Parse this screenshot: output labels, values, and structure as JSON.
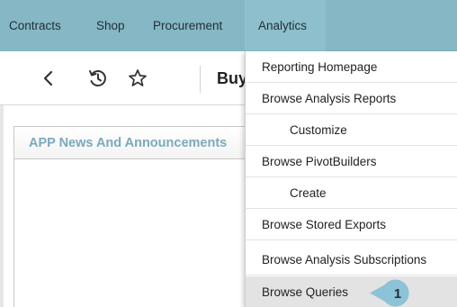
{
  "nav": {
    "items": [
      {
        "label": "Contracts"
      },
      {
        "label": "Shop"
      },
      {
        "label": "Procurement"
      },
      {
        "label": "Analytics"
      }
    ],
    "active_index": 3,
    "bar_color": "#86b7c5"
  },
  "toolbar": {
    "back_icon": "chevron-left-icon",
    "history_icon": "history-icon",
    "favorite_icon": "star-icon",
    "title": "Buy"
  },
  "panel": {
    "title": "APP News And Announcements"
  },
  "analytics_menu": {
    "items": [
      {
        "label": "Reporting Homepage",
        "sub": false
      },
      {
        "label": "Browse Analysis Reports",
        "sub": false
      },
      {
        "label": "Customize",
        "sub": true
      },
      {
        "label": "Browse PivotBuilders",
        "sub": false
      },
      {
        "label": "Create",
        "sub": true
      },
      {
        "label": "Browse Stored Exports",
        "sub": false
      },
      {
        "label": "Browse Analysis Subscriptions",
        "sub": false
      },
      {
        "label": "Browse Queries",
        "sub": false,
        "highlighted": true
      }
    ]
  },
  "callout": {
    "number": "1",
    "color": "#8cc3d6"
  }
}
